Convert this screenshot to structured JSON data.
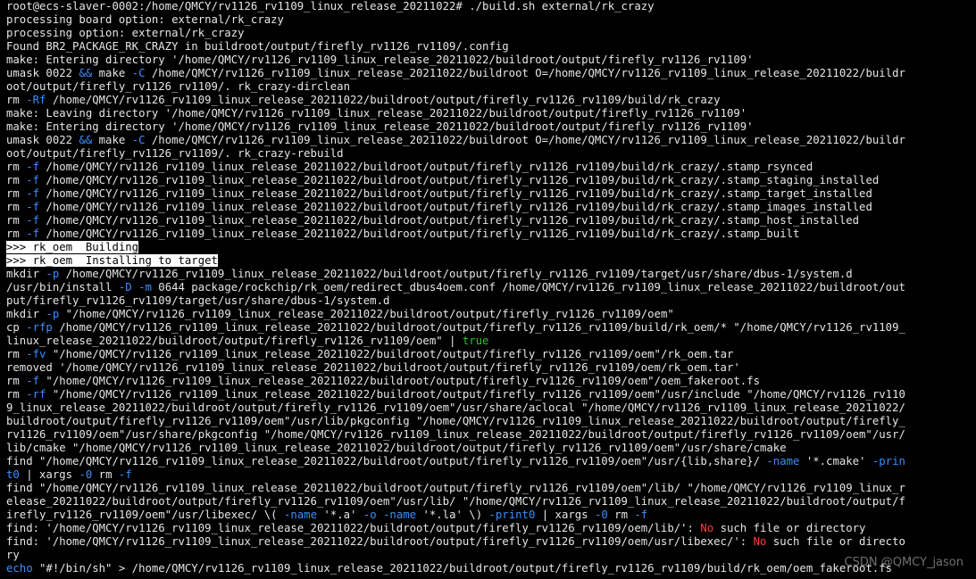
{
  "colors": {
    "background": "#000000",
    "text": "#e6e6e6",
    "blue": "#3d8eff",
    "green": "#2ec22e",
    "red": "#ff3b3b",
    "highlight_bg": "#ffffff",
    "highlight_fg": "#000000"
  },
  "terminal": {
    "lines": [
      [
        {
          "t": "root@ecs-slaver-0002:/home/QMCY/rv1126_rv1109_linux_release_20211022# ./build.sh external/rk_crazy",
          "c": "default"
        }
      ],
      [
        {
          "t": "processing board option: external/rk_crazy",
          "c": "default"
        }
      ],
      [
        {
          "t": "processing option: external/rk_crazy",
          "c": "default"
        }
      ],
      [
        {
          "t": "Found BR2_PACKAGE_RK_CRAZY in buildroot/output/firefly_rv1126_rv1109/.config",
          "c": "default"
        }
      ],
      [
        {
          "t": "make: Entering directory '/home/QMCY/rv1126_rv1109_linux_release_20211022/buildroot/output/firefly_rv1126_rv1109'",
          "c": "default"
        }
      ],
      [
        {
          "t": "umask 0022 ",
          "c": "default"
        },
        {
          "t": "&&",
          "c": "blue"
        },
        {
          "t": " make ",
          "c": "default"
        },
        {
          "t": "-C",
          "c": "blue"
        },
        {
          "t": " /home/QMCY/rv1126_rv1109_linux_release_20211022/buildroot O=/home/QMCY/rv1126_rv1109_linux_release_20211022/buildr",
          "c": "default"
        }
      ],
      [
        {
          "t": "oot/output/firefly_rv1126_rv1109/. rk_crazy-dirclean",
          "c": "default"
        }
      ],
      [
        {
          "t": "rm ",
          "c": "default"
        },
        {
          "t": "-Rf",
          "c": "blue"
        },
        {
          "t": " /home/QMCY/rv1126_rv1109_linux_release_20211022/buildroot/output/firefly_rv1126_rv1109/build/rk_crazy",
          "c": "default"
        }
      ],
      [
        {
          "t": "make: Leaving directory '/home/QMCY/rv1126_rv1109_linux_release_20211022/buildroot/output/firefly_rv1126_rv1109'",
          "c": "default"
        }
      ],
      [
        {
          "t": "make: Entering directory '/home/QMCY/rv1126_rv1109_linux_release_20211022/buildroot/output/firefly_rv1126_rv1109'",
          "c": "default"
        }
      ],
      [
        {
          "t": "umask 0022 ",
          "c": "default"
        },
        {
          "t": "&&",
          "c": "blue"
        },
        {
          "t": " make ",
          "c": "default"
        },
        {
          "t": "-C",
          "c": "blue"
        },
        {
          "t": " /home/QMCY/rv1126_rv1109_linux_release_20211022/buildroot O=/home/QMCY/rv1126_rv1109_linux_release_20211022/buildr",
          "c": "default"
        }
      ],
      [
        {
          "t": "oot/output/firefly_rv1126_rv1109/. rk_crazy-rebuild",
          "c": "default"
        }
      ],
      [
        {
          "t": "rm ",
          "c": "default"
        },
        {
          "t": "-f",
          "c": "blue"
        },
        {
          "t": " /home/QMCY/rv1126_rv1109_linux_release_20211022/buildroot/output/firefly_rv1126_rv1109/build/rk_crazy/.stamp_rsynced",
          "c": "default"
        }
      ],
      [
        {
          "t": "rm ",
          "c": "default"
        },
        {
          "t": "-f",
          "c": "blue"
        },
        {
          "t": " /home/QMCY/rv1126_rv1109_linux_release_20211022/buildroot/output/firefly_rv1126_rv1109/build/rk_crazy/.stamp_staging_installed",
          "c": "default"
        }
      ],
      [
        {
          "t": "rm ",
          "c": "default"
        },
        {
          "t": "-f",
          "c": "blue"
        },
        {
          "t": " /home/QMCY/rv1126_rv1109_linux_release_20211022/buildroot/output/firefly_rv1126_rv1109/build/rk_crazy/.stamp_target_installed",
          "c": "default"
        }
      ],
      [
        {
          "t": "rm ",
          "c": "default"
        },
        {
          "t": "-f",
          "c": "blue"
        },
        {
          "t": " /home/QMCY/rv1126_rv1109_linux_release_20211022/buildroot/output/firefly_rv1126_rv1109/build/rk_crazy/.stamp_images_installed",
          "c": "default"
        }
      ],
      [
        {
          "t": "rm ",
          "c": "default"
        },
        {
          "t": "-f",
          "c": "blue"
        },
        {
          "t": " /home/QMCY/rv1126_rv1109_linux_release_20211022/buildroot/output/firefly_rv1126_rv1109/build/rk_crazy/.stamp_host_installed",
          "c": "default"
        }
      ],
      [
        {
          "t": "rm ",
          "c": "default"
        },
        {
          "t": "-f",
          "c": "blue"
        },
        {
          "t": " /home/QMCY/rv1126_rv1109_linux_release_20211022/buildroot/output/firefly_rv1126_rv1109/build/rk_crazy/.stamp_built",
          "c": "default"
        }
      ],
      [
        {
          "t": ">>> rk_oem  Building",
          "c": "highlight"
        }
      ],
      [
        {
          "t": ">>> rk_oem  Installing to target",
          "c": "highlight"
        }
      ],
      [
        {
          "t": "mkdir ",
          "c": "default"
        },
        {
          "t": "-p",
          "c": "blue"
        },
        {
          "t": " /home/QMCY/rv1126_rv1109_linux_release_20211022/buildroot/output/firefly_rv1126_rv1109/target/usr/share/dbus-1/system.d",
          "c": "default"
        }
      ],
      [
        {
          "t": "/usr/bin/install ",
          "c": "default"
        },
        {
          "t": "-D",
          "c": "blue"
        },
        {
          "t": " ",
          "c": "default"
        },
        {
          "t": "-m",
          "c": "blue"
        },
        {
          "t": " 0644 package/rockchip/rk_oem/redirect_dbus4oem.conf /home/QMCY/rv1126_rv1109_linux_release_20211022/buildroot/out",
          "c": "default"
        }
      ],
      [
        {
          "t": "put/firefly_rv1126_rv1109/target/usr/share/dbus-1/system.d",
          "c": "default"
        }
      ],
      [
        {
          "t": "mkdir ",
          "c": "default"
        },
        {
          "t": "-p",
          "c": "blue"
        },
        {
          "t": " \"/home/QMCY/rv1126_rv1109_linux_release_20211022/buildroot/output/firefly_rv1126_rv1109/oem\"",
          "c": "default"
        }
      ],
      [
        {
          "t": "cp ",
          "c": "default"
        },
        {
          "t": "-rfp",
          "c": "blue"
        },
        {
          "t": " /home/QMCY/rv1126_rv1109_linux_release_20211022/buildroot/output/firefly_rv1126_rv1109/build/rk_oem/* \"/home/QMCY/rv1126_rv1109_",
          "c": "default"
        }
      ],
      [
        {
          "t": "linux_release_20211022/buildroot/output/firefly_rv1126_rv1109/oem\" | ",
          "c": "default"
        },
        {
          "t": "true",
          "c": "green"
        }
      ],
      [
        {
          "t": "rm ",
          "c": "default"
        },
        {
          "t": "-fv",
          "c": "blue"
        },
        {
          "t": " \"/home/QMCY/rv1126_rv1109_linux_release_20211022/buildroot/output/firefly_rv1126_rv1109/oem\"/rk_oem.tar",
          "c": "default"
        }
      ],
      [
        {
          "t": "removed '/home/QMCY/rv1126_rv1109_linux_release_20211022/buildroot/output/firefly_rv1126_rv1109/oem/rk_oem.tar'",
          "c": "default"
        }
      ],
      [
        {
          "t": "rm ",
          "c": "default"
        },
        {
          "t": "-f",
          "c": "blue"
        },
        {
          "t": " \"/home/QMCY/rv1126_rv1109_linux_release_20211022/buildroot/output/firefly_rv1126_rv1109/oem\"/oem_fakeroot.fs",
          "c": "default"
        }
      ],
      [
        {
          "t": "rm ",
          "c": "default"
        },
        {
          "t": "-rf",
          "c": "blue"
        },
        {
          "t": " \"/home/QMCY/rv1126_rv1109_linux_release_20211022/buildroot/output/firefly_rv1126_rv1109/oem\"/usr/include \"/home/QMCY/rv1126_rv110",
          "c": "default"
        }
      ],
      [
        {
          "t": "9_linux_release_20211022/buildroot/output/firefly_rv1126_rv1109/oem\"/usr/share/aclocal \"/home/QMCY/rv1126_rv1109_linux_release_20211022/",
          "c": "default"
        }
      ],
      [
        {
          "t": "buildroot/output/firefly_rv1126_rv1109/oem\"/usr/lib/pkgconfig \"/home/QMCY/rv1126_rv1109_linux_release_20211022/buildroot/output/firefly_",
          "c": "default"
        }
      ],
      [
        {
          "t": "rv1126_rv1109/oem\"/usr/share/pkgconfig \"/home/QMCY/rv1126_rv1109_linux_release_20211022/buildroot/output/firefly_rv1126_rv1109/oem\"/usr/",
          "c": "default"
        }
      ],
      [
        {
          "t": "lib/cmake \"/home/QMCY/rv1126_rv1109_linux_release_20211022/buildroot/output/firefly_rv1126_rv1109/oem\"/usr/share/cmake",
          "c": "default"
        }
      ],
      [
        {
          "t": "find \"/home/QMCY/rv1126_rv1109_linux_release_20211022/buildroot/output/firefly_rv1126_rv1109/oem\"/usr/{lib,share}/ ",
          "c": "default"
        },
        {
          "t": "-name",
          "c": "blue"
        },
        {
          "t": " '*.cmake' ",
          "c": "default"
        },
        {
          "t": "-prin",
          "c": "blue"
        }
      ],
      [
        {
          "t": "t0",
          "c": "blue"
        },
        {
          "t": " | xargs ",
          "c": "default"
        },
        {
          "t": "-0",
          "c": "blue"
        },
        {
          "t": " rm ",
          "c": "default"
        },
        {
          "t": "-f",
          "c": "blue"
        }
      ],
      [
        {
          "t": "find \"/home/QMCY/rv1126_rv1109_linux_release_20211022/buildroot/output/firefly_rv1126_rv1109/oem\"/lib/ \"/home/QMCY/rv1126_rv1109_linux_r",
          "c": "default"
        }
      ],
      [
        {
          "t": "elease_20211022/buildroot/output/firefly_rv1126_rv1109/oem\"/usr/lib/ \"/home/QMCY/rv1126_rv1109_linux_release_20211022/buildroot/output/f",
          "c": "default"
        }
      ],
      [
        {
          "t": "irefly_rv1126_rv1109/oem\"/usr/libexec/ \\( ",
          "c": "default"
        },
        {
          "t": "-name",
          "c": "blue"
        },
        {
          "t": " '*.a' ",
          "c": "default"
        },
        {
          "t": "-o",
          "c": "blue"
        },
        {
          "t": " ",
          "c": "default"
        },
        {
          "t": "-name",
          "c": "blue"
        },
        {
          "t": " '*.la' \\) ",
          "c": "default"
        },
        {
          "t": "-print0",
          "c": "blue"
        },
        {
          "t": " | xargs ",
          "c": "default"
        },
        {
          "t": "-0",
          "c": "blue"
        },
        {
          "t": " rm ",
          "c": "default"
        },
        {
          "t": "-f",
          "c": "blue"
        }
      ],
      [
        {
          "t": "find: '/home/QMCY/rv1126_rv1109_linux_release_20211022/buildroot/output/firefly_rv1126_rv1109/oem/lib/': ",
          "c": "default"
        },
        {
          "t": "No",
          "c": "red"
        },
        {
          "t": " such file or directory",
          "c": "default"
        }
      ],
      [
        {
          "t": "find: '/home/QMCY/rv1126_rv1109_linux_release_20211022/buildroot/output/firefly_rv1126_rv1109/oem/usr/libexec/': ",
          "c": "default"
        },
        {
          "t": "No",
          "c": "red"
        },
        {
          "t": " such file or directo",
          "c": "default"
        }
      ],
      [
        {
          "t": "ry",
          "c": "default"
        }
      ],
      [
        {
          "t": "echo",
          "c": "blue"
        },
        {
          "t": " \"#!/bin/sh\" > /home/QMCY/rv1126_rv1109_linux_release_20211022/buildroot/output/firefly_rv1126_rv1109/build/rk_oem/oem_fakeroot.fs",
          "c": "default"
        }
      ]
    ]
  },
  "watermark": "CSDN @QMCY_jason"
}
